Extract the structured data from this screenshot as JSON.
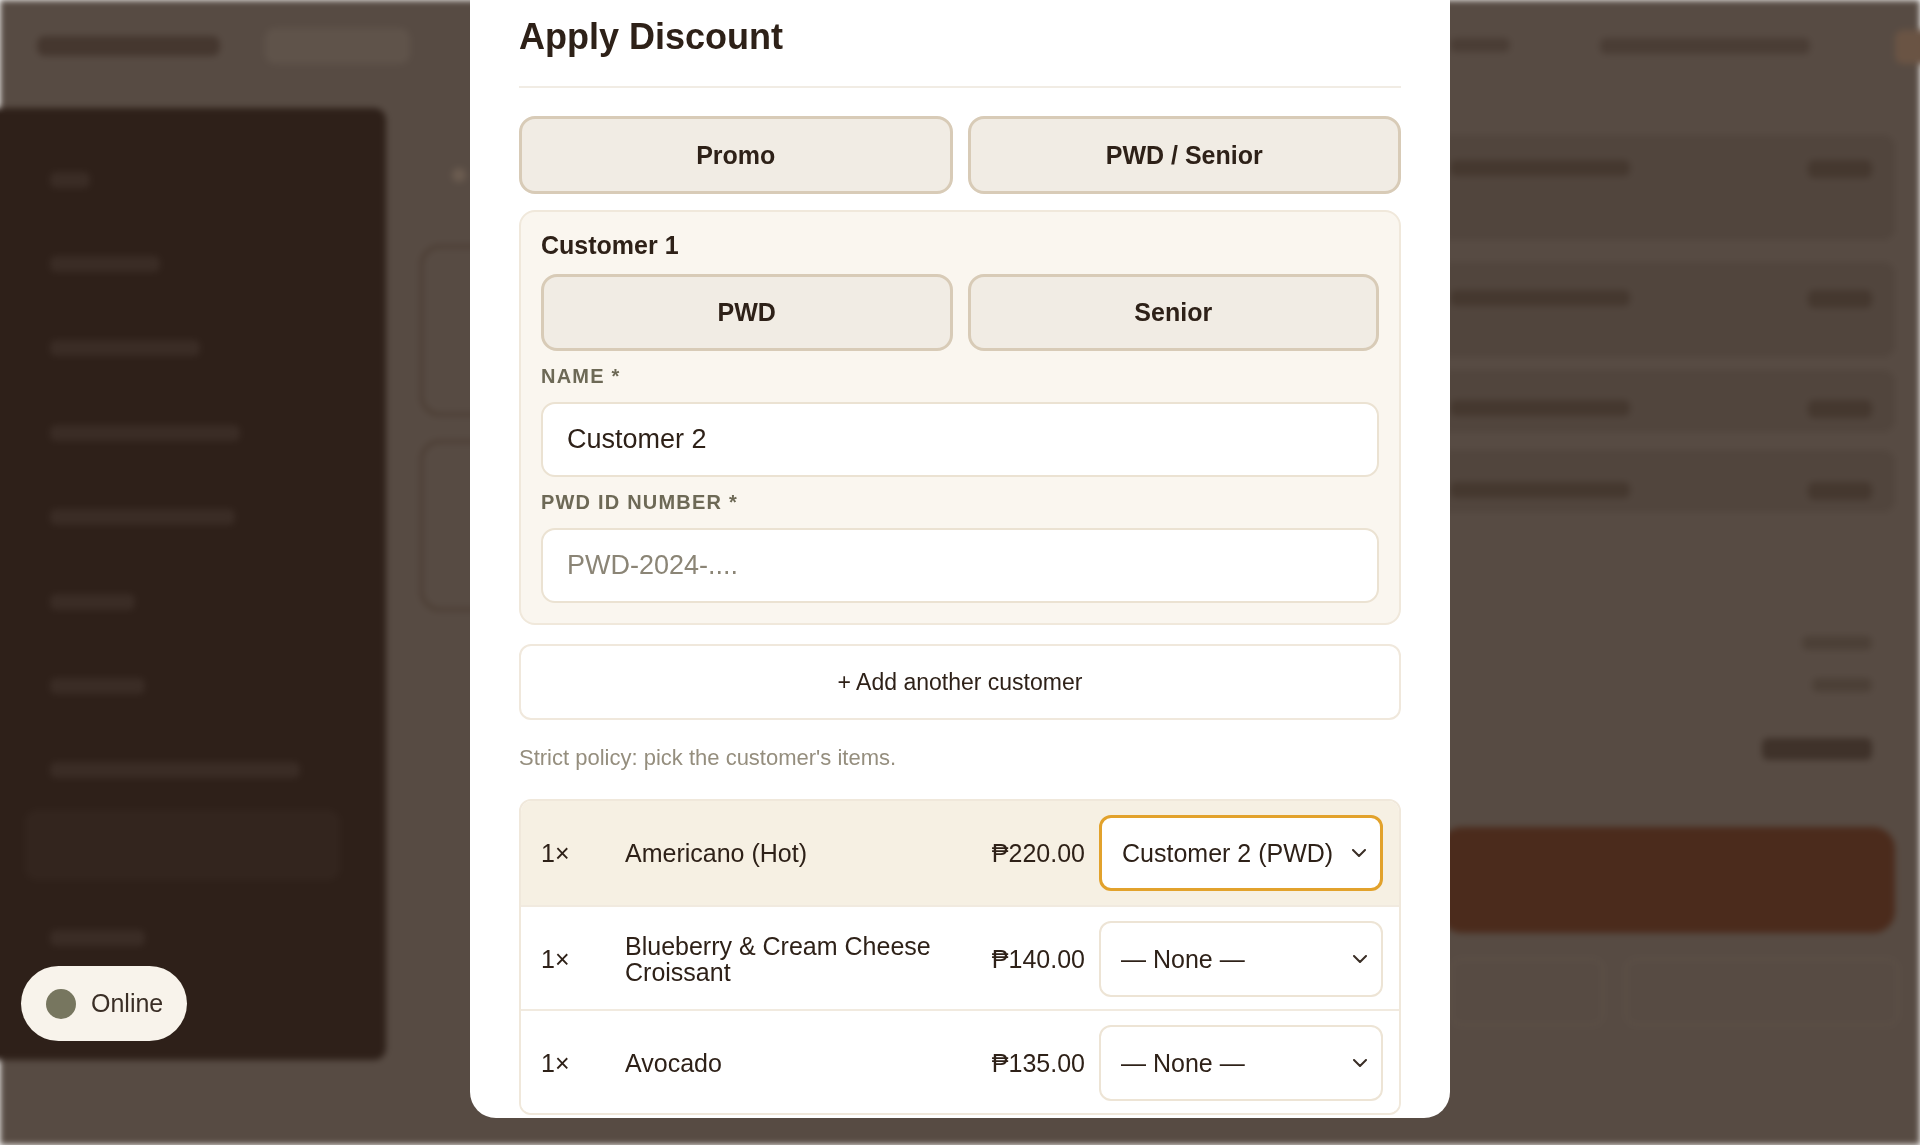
{
  "dialog": {
    "title": "Apply Discount",
    "tabs": [
      {
        "label": "Promo",
        "selected": false
      },
      {
        "label": "PWD / Senior",
        "selected": false
      }
    ],
    "customers": [
      {
        "heading": "Customer 1",
        "types": [
          {
            "label": "PWD",
            "selected": false
          },
          {
            "label": "Senior",
            "selected": false
          }
        ],
        "fields": [
          {
            "label": "NAME *",
            "value": "Customer 2"
          },
          {
            "label": "PWD ID NUMBER *",
            "placeholder": "PWD-2024-...."
          }
        ]
      }
    ],
    "add_customer_button": "+ Add another customer",
    "policy_note": "Strict policy: pick the customer's items.",
    "items": [
      {
        "qty": "1×",
        "name": "Americano (Hot)",
        "price": "₱220.00",
        "assignee": "Customer 2 (PWD)",
        "selected": true,
        "focused": true
      },
      {
        "qty": "1×",
        "name": "Blueberry & Cream Cheese Croissant",
        "price": "₱140.00",
        "assignee": "— None —",
        "selected": false,
        "focused": false
      },
      {
        "qty": "1×",
        "name": "Avocado",
        "price": "₱135.00",
        "assignee": "— None —",
        "selected": false,
        "focused": false
      }
    ]
  },
  "connection_status": {
    "label": "Online",
    "color": "#77765f"
  }
}
